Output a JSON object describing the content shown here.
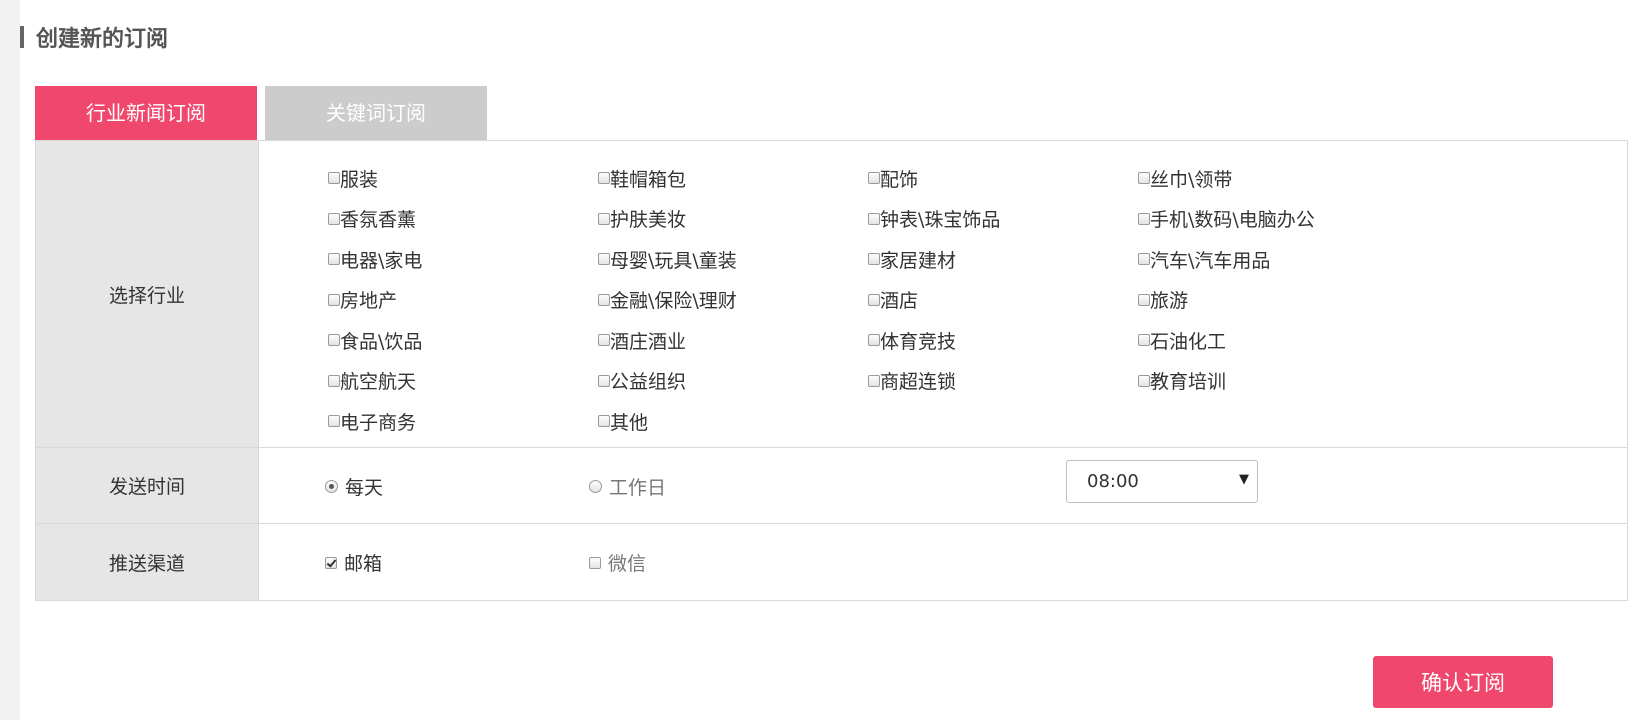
{
  "header": {
    "title": "创建新的订阅"
  },
  "tabs": [
    {
      "label": "行业新闻订阅",
      "active": true
    },
    {
      "label": "关键词订阅",
      "active": false
    }
  ],
  "industry": {
    "label": "选择行业",
    "items": [
      "服装",
      "鞋帽箱包",
      "配饰",
      "丝巾\\领带",
      "香氛香薰",
      "护肤美妆",
      "钟表\\珠宝饰品",
      "手机\\数码\\电脑办公",
      "电器\\家电",
      "母婴\\玩具\\童装",
      "家居建材",
      "汽车\\汽车用品",
      "房地产",
      "金融\\保险\\理财",
      "酒店",
      "旅游",
      "食品\\饮品",
      "酒庄酒业",
      "体育竞技",
      "石油化工",
      "航空航天",
      "公益组织",
      "商超连锁",
      "教育培训",
      "电子商务",
      "其他"
    ]
  },
  "send_time": {
    "label": "发送时间",
    "options": [
      {
        "label": "每天",
        "checked": true
      },
      {
        "label": "工作日",
        "checked": false
      }
    ],
    "time_value": "08:00"
  },
  "channel": {
    "label": "推送渠道",
    "options": [
      {
        "label": "邮箱",
        "checked": true
      },
      {
        "label": "微信",
        "checked": false
      }
    ]
  },
  "actions": {
    "confirm_label": "确认订阅"
  },
  "colors": {
    "accent": "#f0476d",
    "inactive_tab": "#cccccc",
    "label_bg": "#e6e6e6"
  }
}
